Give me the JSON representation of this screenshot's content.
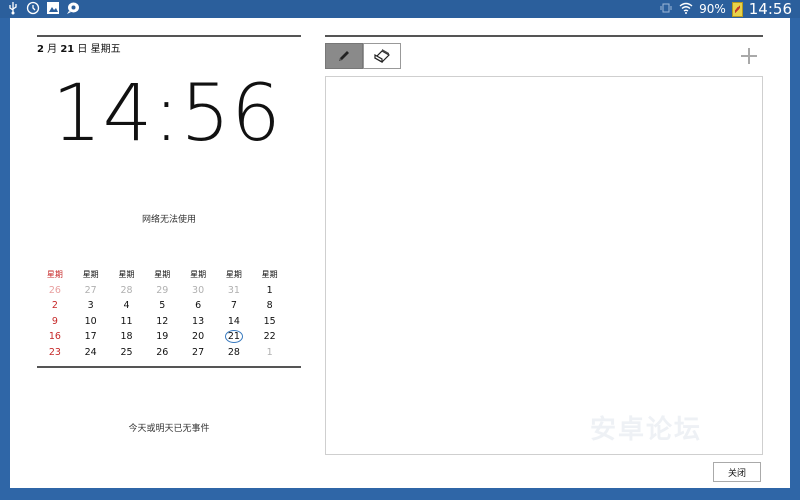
{
  "status_bar": {
    "icons": [
      "usb-icon",
      "sync-icon",
      "image-icon",
      "chat-icon"
    ],
    "right_icons": [
      "vibrate-icon",
      "wifi-icon",
      "battery-icon"
    ],
    "battery_percent": "90%",
    "time": "14:56"
  },
  "widget": {
    "date_month": "2",
    "date_month_unit": " 月 ",
    "date_day": "21",
    "date_day_unit": " 日 ",
    "date_weekday": "星期五",
    "clock": "14:56",
    "network_status": "网络无法使用",
    "calendar": {
      "headers": [
        "星期",
        "星期",
        "星期",
        "星期",
        "星期",
        "星期",
        "星期"
      ],
      "weeks": [
        [
          "26",
          "27",
          "28",
          "29",
          "30",
          "31",
          "1"
        ],
        [
          "2",
          "3",
          "4",
          "5",
          "6",
          "7",
          "8"
        ],
        [
          "9",
          "10",
          "11",
          "12",
          "13",
          "14",
          "15"
        ],
        [
          "16",
          "17",
          "18",
          "19",
          "20",
          "21",
          "22"
        ],
        [
          "23",
          "24",
          "25",
          "26",
          "27",
          "28",
          "1"
        ]
      ],
      "today": "21"
    },
    "no_events": "今天或明天已无事件"
  },
  "memo": {
    "pen_tool": "pen-icon",
    "eraser_tool": "eraser-icon",
    "add": "plus-icon",
    "watermark": "安卓论坛",
    "close_label": "关闭"
  },
  "colors": {
    "background": "#2f66a7",
    "sunday": "#c62828",
    "today_ring": "#3a7bbf"
  }
}
